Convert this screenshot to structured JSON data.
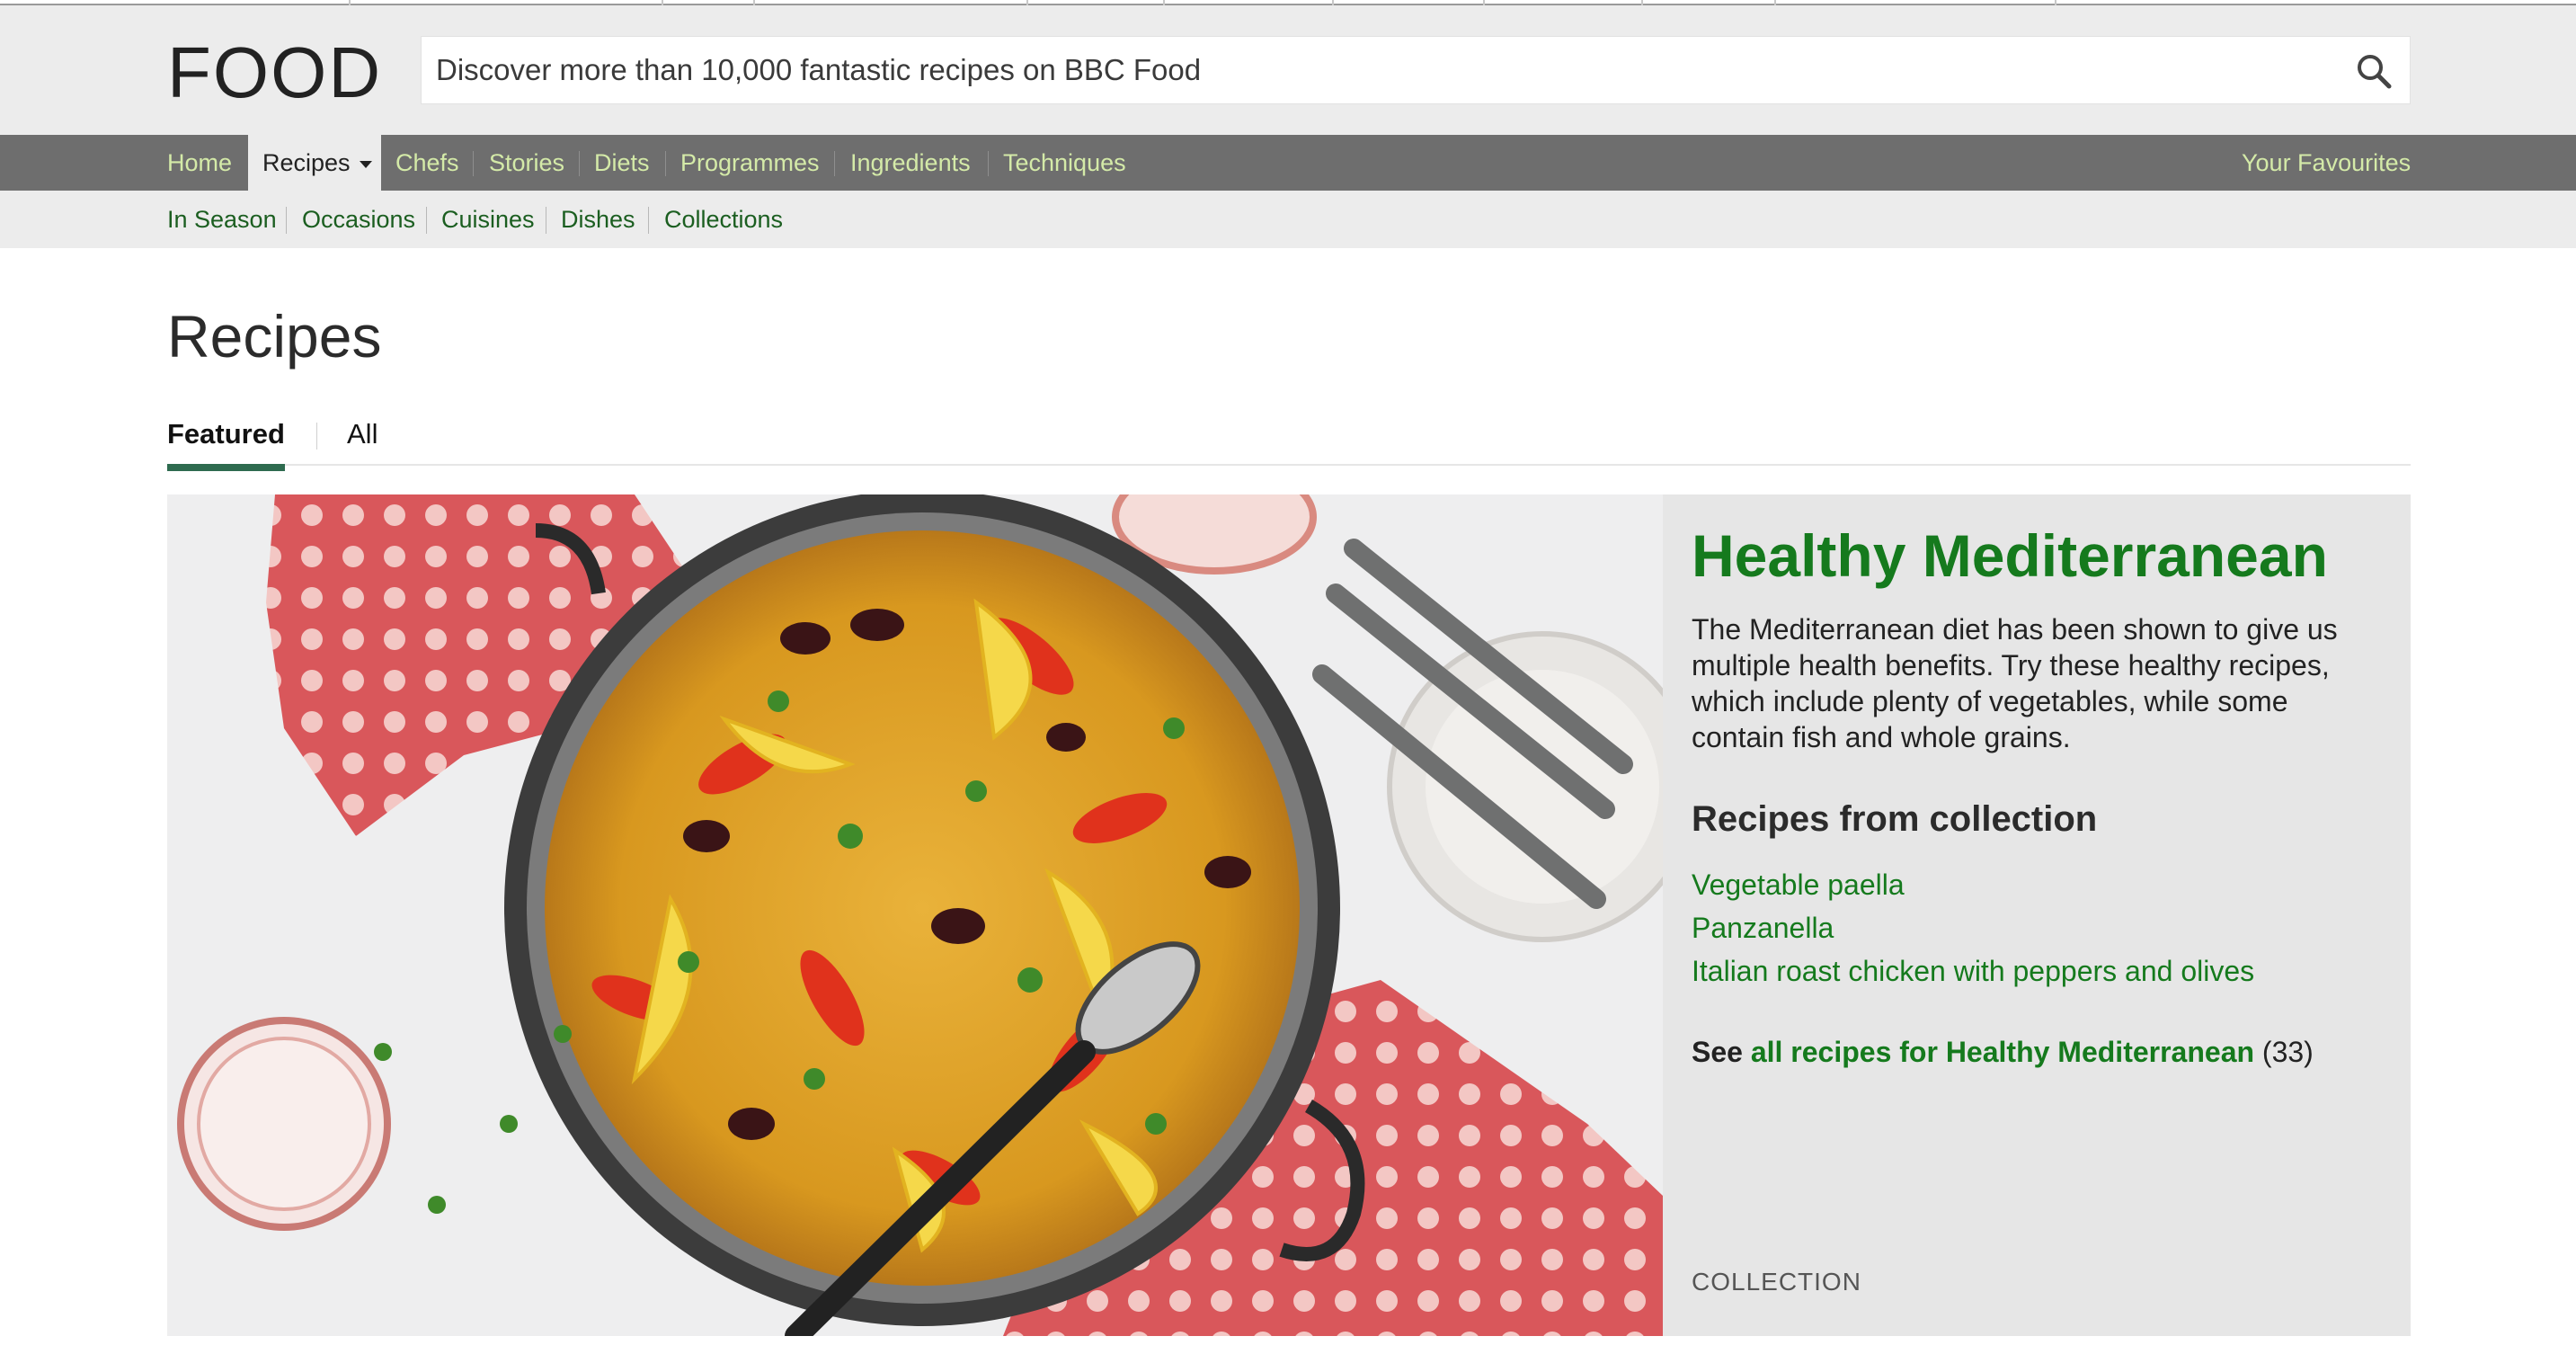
{
  "header": {
    "logo": "FOOD",
    "search_placeholder": "Discover more than 10,000 fantastic recipes on BBC Food"
  },
  "nav": {
    "items": [
      {
        "label": "Home"
      },
      {
        "label": "Recipes",
        "active": true
      },
      {
        "label": "Chefs"
      },
      {
        "label": "Stories"
      },
      {
        "label": "Diets"
      },
      {
        "label": "Programmes"
      },
      {
        "label": "Ingredients"
      },
      {
        "label": "Techniques"
      }
    ],
    "favourites": "Your Favourites"
  },
  "subnav": {
    "items": [
      "In Season",
      "Occasions",
      "Cuisines",
      "Dishes",
      "Collections"
    ]
  },
  "page": {
    "title": "Recipes",
    "tabs": [
      {
        "label": "Featured",
        "active": true
      },
      {
        "label": "All",
        "active": false
      }
    ]
  },
  "feature": {
    "image_icon": "paella-photo",
    "title": "Healthy Mediterranean",
    "description": "The Mediterranean diet has been shown to give us multiple health benefits. Try these healthy recipes, which include plenty of vegetables, while some contain fish and whole grains.",
    "recipes_heading": "Recipes from collection",
    "recipes": [
      "Vegetable paella",
      "Panzanella",
      "Italian roast chicken with peppers and olives"
    ],
    "see_all_prefix": "See",
    "see_all_link": "all recipes for Healthy Mediterranean",
    "see_all_count": "(33)",
    "label": "COLLECTION"
  },
  "colors": {
    "nav_bg": "#6e6e6e",
    "nav_link": "#d4eaa8",
    "link_green": "#157a1d",
    "tab_underline": "#2e6b4f",
    "header_bg": "#ececec"
  }
}
